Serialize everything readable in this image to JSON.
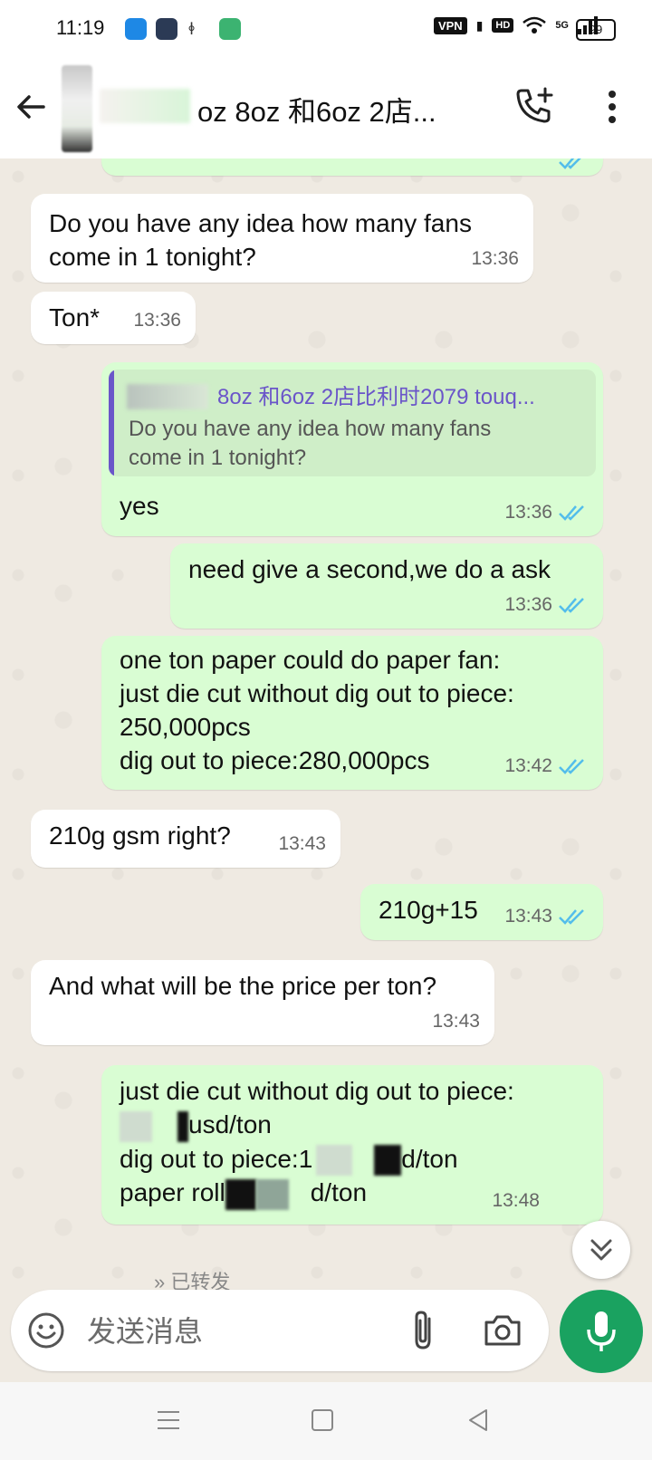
{
  "status_bar": {
    "time": "11:19",
    "vpn": "VPN",
    "hd": "HD",
    "network": "5G",
    "battery": "99"
  },
  "header": {
    "title": "oz 8oz 和6oz 2店..."
  },
  "messages": [
    {
      "dir": "in",
      "text": "Do you have any idea how many fans\ncome in 1 tonight?",
      "time": "13:36"
    },
    {
      "dir": "in",
      "text": "Ton*",
      "time": "13:36"
    },
    {
      "dir": "out",
      "quote_name": "8oz 和6oz 2店比利时2079 touq...",
      "quote_text": "Do you have any idea how many fans\ncome in 1 tonight?",
      "text": "yes",
      "time": "13:36"
    },
    {
      "dir": "out",
      "text": "need give a second,we do a ask",
      "time": "13:36"
    },
    {
      "dir": "out",
      "lines": [
        "one ton paper could do paper fan:",
        "just die cut without dig out to piece:",
        "250,000pcs",
        "dig out to piece:280,000pcs"
      ],
      "time": "13:42"
    },
    {
      "dir": "in",
      "text": "210g gsm right?",
      "time": "13:43"
    },
    {
      "dir": "out",
      "text": "210g+15",
      "time": "13:43"
    },
    {
      "dir": "in",
      "text": "And what will be the price per ton?",
      "time": "13:43"
    },
    {
      "dir": "out",
      "line1": "just die cut without dig out to piece:",
      "line2_suffix": "usd/ton",
      "line3_prefix": "dig out to piece:1",
      "line3_suffix": "d/ton",
      "line4_prefix": "paper roll",
      "line4_suffix": "d/ton",
      "time": "13:48"
    }
  ],
  "forwarded_label": "已转发",
  "composer": {
    "placeholder": "发送消息"
  },
  "colors": {
    "outgoing_bubble": "#d9fdd3",
    "incoming_bubble": "#ffffff",
    "accent": "#1aa260",
    "tick_blue": "#53bdeb"
  }
}
